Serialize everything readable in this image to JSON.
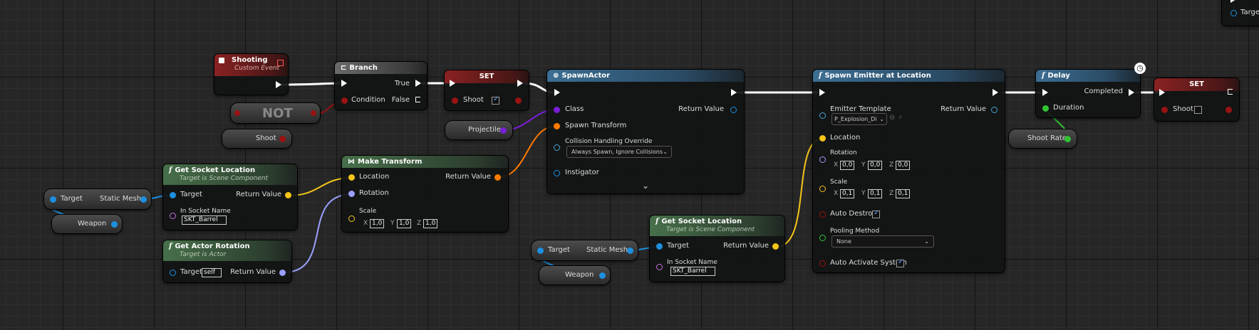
{
  "colors": {
    "exec": "#ffffff",
    "object": "#1e8fe0",
    "vector": "#f5c518",
    "rotator": "#9aa0ff",
    "transform": "#ff7a00",
    "bool": "#9a1212",
    "class": "#7a1fd6",
    "float": "#30c330",
    "name": "#c66cd9",
    "generic": "#4aa0d0"
  },
  "shooting_event": {
    "title": "Shooting",
    "subtitle": "Custom Event"
  },
  "not_node": {
    "label": "NOT"
  },
  "shoot_getter": {
    "label": "Shoot"
  },
  "branch": {
    "title": "Branch",
    "true_label": "True",
    "false_label": "False",
    "condition_label": "Condition"
  },
  "set_shoot_true": {
    "title": "SET",
    "pin_label": "Shoot"
  },
  "projectile_var": {
    "label": "Projectile"
  },
  "spawn_actor": {
    "title": "SpawnActor",
    "class_label": "Class",
    "return_label": "Return Value",
    "transform_label": "Spawn Transform",
    "collision_label": "Collision Handling Override",
    "collision_value": "Always Spawn, Ignore Collisions",
    "instigator_label": "Instigator"
  },
  "spawn_emitter": {
    "title": "Spawn Emitter at Location",
    "template_label": "Emitter Template",
    "template_value": "P_Explosion_Di",
    "return_label": "Return Value",
    "location_label": "Location",
    "rotation_label": "Rotation",
    "rot_x": "0,0",
    "rot_y": "0,0",
    "rot_z": "0,0",
    "scale_label": "Scale",
    "scale_x": "0,1",
    "scale_y": "0,1",
    "scale_z": "0,1",
    "auto_destroy_label": "Auto Destroy",
    "pooling_label": "Pooling Method",
    "pooling_value": "None",
    "auto_activate_label": "Auto Activate System"
  },
  "delay": {
    "title": "Delay",
    "completed_label": "Completed",
    "duration_label": "Duration"
  },
  "shoot_rate_var": {
    "label": "Shoot Rate"
  },
  "set_shoot_false": {
    "title": "SET",
    "pin_label": "Shoot"
  },
  "corner_node": {
    "target_label": "Target"
  },
  "static_mesh_1": {
    "target_label": "Target",
    "label": "Static Mesh"
  },
  "weapon_1": {
    "label": "Weapon"
  },
  "socket_loc_1": {
    "title": "Get Socket Location",
    "subtitle": "Target is Scene Component",
    "target_label": "Target",
    "return_label": "Return Value",
    "socket_label": "In Socket Name",
    "socket_value": "SKT_Barrel"
  },
  "make_transform": {
    "title": "Make Transform",
    "location_label": "Location",
    "return_label": "Return Value",
    "rotation_label": "Rotation",
    "scale_label": "Scale",
    "sx": "1,0",
    "sy": "1,0",
    "sz": "1,0"
  },
  "actor_rot": {
    "title": "Get Actor Rotation",
    "subtitle": "Target is Actor",
    "target_label": "Target",
    "target_value": "self",
    "return_label": "Return Value"
  },
  "static_mesh_2": {
    "target_label": "Target",
    "label": "Static Mesh"
  },
  "weapon_2": {
    "label": "Weapon"
  },
  "socket_loc_2": {
    "title": "Get Socket Location",
    "subtitle": "Target is Scene Component",
    "target_label": "Target",
    "return_label": "Return Value",
    "socket_label": "In Socket Name",
    "socket_value": "SKT_Barrel"
  },
  "axes": {
    "x": "X",
    "y": "Y",
    "z": "Z"
  }
}
